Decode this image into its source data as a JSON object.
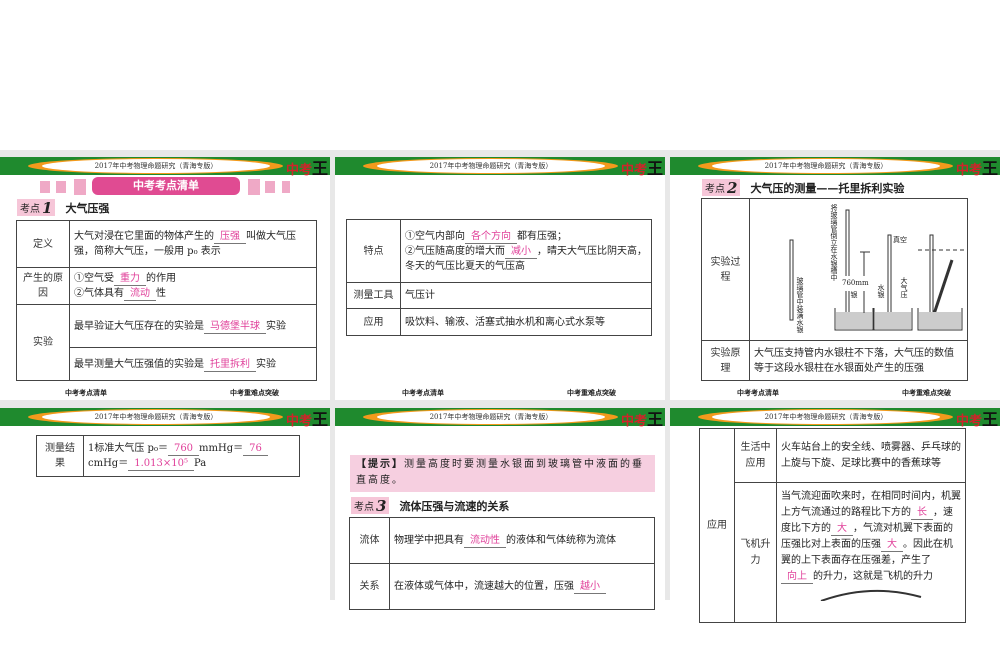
{
  "header_title": "2017年中考物理命题研究（青海专版）",
  "logo": {
    "a": "中考",
    "b": "王"
  },
  "footer": {
    "left": "中考考点清单",
    "right": "中考重难点突破"
  },
  "colors": {
    "header_green": "#1f8a2e",
    "accent_pink": "#e04b92",
    "answer_pink": "#e0409a"
  },
  "slide1": {
    "banner": "中考考点清单",
    "kaodian": {
      "label": "考点",
      "num": "1",
      "title": "大气压强"
    },
    "rows": [
      {
        "head": "定义",
        "pre": "大气对浸在它里面的物体产生的",
        "ans": "压强",
        "post": "叫做大气压强，简称大气压，一般用 p₀ 表示"
      },
      {
        "head": "产生的原因",
        "l1pre": "①空气受",
        "l1ans": "重力",
        "l1post": "的作用",
        "l2pre": "②气体具有",
        "l2ans": "流动",
        "l2post": "性"
      },
      {
        "head": "实验",
        "a_pre": "最早验证大气压存在的实验是",
        "a_ans": "马德堡半球",
        "a_post": "实验",
        "b_pre": "最早测量大气压强值的实验是",
        "b_ans": "托里拆利",
        "b_post": "实验"
      }
    ]
  },
  "slide2": {
    "rows": [
      {
        "head": "特点",
        "l1pre": "①空气内部向",
        "l1ans": "各个方向",
        "l1post": "都有压强；",
        "l2pre": "②气压随高度的增大而",
        "l2ans": "减小",
        "l2post": "，晴天大气压比阴天高，冬天的气压比夏天的气压高"
      },
      {
        "head": "测量工具",
        "text": "气压计"
      },
      {
        "head": "应用",
        "text": "吸饮料、输液、活塞式抽水机和离心式水泵等"
      }
    ]
  },
  "slide3": {
    "kaodian": {
      "label": "考点",
      "num": "2",
      "title": "大气压的测量——托里拆利实验"
    },
    "process_head": "实验过程",
    "diagram": {
      "l1": "玻璃管中装满水银",
      "l2": "将玻璃管倒立在水银槽中",
      "l3": "水银",
      "l4": "水银",
      "l5": "大气压",
      "vacuum": "真空",
      "height": "760mm"
    },
    "principle_head": "实验原理",
    "principle": "大气压支持管内水银柱不下落，大气压的数值等于这段水银柱在水银面处产生的压强"
  },
  "slide4": {
    "head": "测量结果",
    "pre": "1标准大气压 p₀＝",
    "a1": "760",
    "mid1": "mmHg＝",
    "a2": "76",
    "mid2": "cmHg＝",
    "a3": "1.013×10⁵",
    "post": "Pa"
  },
  "slide5": {
    "tip_label": "【提示】",
    "tip": "测量高度时要测量水银面到玻璃管中液面的垂直高度。",
    "kaodian": {
      "label": "考点",
      "num": "3",
      "title": "流体压强与流速的关系"
    },
    "rows": [
      {
        "head": "流体",
        "pre": "物理学中把具有",
        "ans": "流动性",
        "post": "的液体和气体统称为流体"
      },
      {
        "head": "关系",
        "pre": "在液体或气体中，流速越大的位置，压强",
        "ans": "越小",
        "post": ""
      }
    ]
  },
  "slide6": {
    "head": "应用",
    "rows": [
      {
        "head": "生活中应用",
        "text": "火车站台上的安全线、喷雾器、乒乓球的上旋与下旋、足球比赛中的香蕉球等"
      },
      {
        "head": "飞机升力",
        "p1": "当气流迎面吹来时，在相同时间内，机翼上方气流通过的路程比下方的",
        "a1": "长",
        "p2": "，速度比下方的",
        "a2": "大",
        "p3": "，气流对机翼下表面的压强比对上表面的压强",
        "a3": "大",
        "p4": "。因此在机翼的上下表面存在压强差，产生了",
        "a4": "向上",
        "p5": "的升力，这就是飞机的升力"
      }
    ]
  }
}
